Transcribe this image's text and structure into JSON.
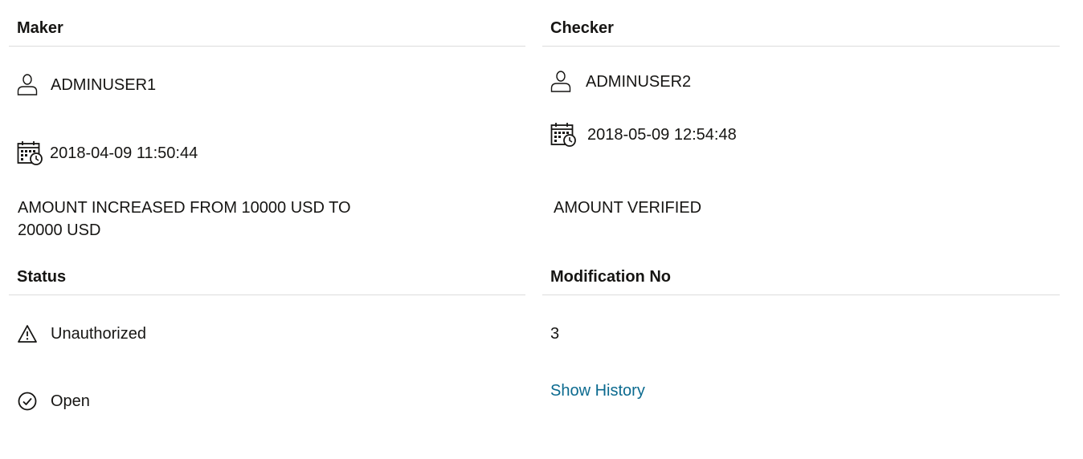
{
  "maker": {
    "title": "Maker",
    "user": "ADMINUSER1",
    "datetime": "2018-04-09 11:50:44",
    "remarks": "AMOUNT INCREASED FROM 10000 USD TO 20000 USD",
    "user_icon": "person-icon",
    "date_icon": "calendar-clock-icon"
  },
  "checker": {
    "title": "Checker",
    "user": "ADMINUSER2",
    "datetime": "2018-05-09 12:54:48",
    "remarks": "AMOUNT VERIFIED",
    "user_icon": "person-icon",
    "date_icon": "calendar-clock-icon"
  },
  "status": {
    "title": "Status",
    "authorization": "Unauthorized",
    "authorization_icon": "warning-triangle-icon",
    "record_status": "Open",
    "record_status_icon": "check-circle-icon"
  },
  "modification": {
    "title": "Modification No",
    "number": "3",
    "history_link": "Show History"
  },
  "colors": {
    "text": "#161513",
    "link": "#0b6a8f",
    "divider": "#dcdcdc"
  }
}
